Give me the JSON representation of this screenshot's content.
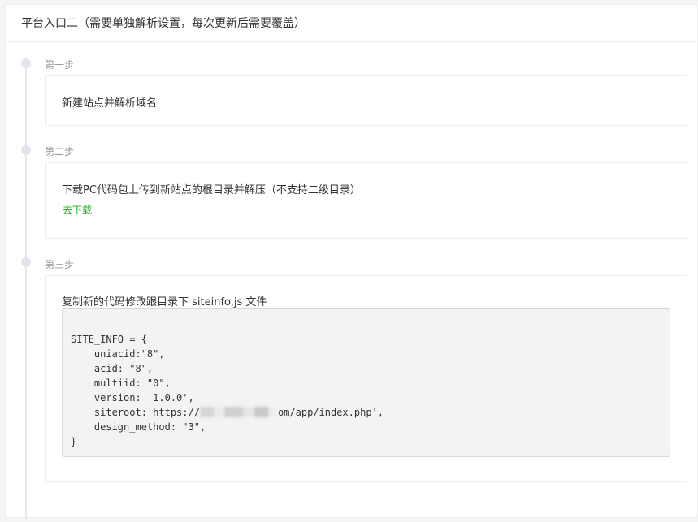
{
  "header": {
    "title": "平台入口二（需要单独解析设置，每次更新后需要覆盖）"
  },
  "steps": [
    {
      "title": "第一步",
      "text": "新建站点并解析域名"
    },
    {
      "title": "第二步",
      "text": "下载PC代码包上传到新站点的根目录并解压（不支持二级目录）",
      "link": "去下载"
    },
    {
      "title": "第三步",
      "text": "复制新的代码修改跟目录下 siteinfo.js 文件"
    }
  ],
  "code": {
    "line1": "SITE_INFO = {",
    "line2": "    uniacid:\"8\",",
    "line3": "    acid: \"8\",",
    "line4": "    multiid: \"0\",",
    "line5": "    version: '1.0.0',",
    "line6_prefix": "    siteroot: https://",
    "line6_suffix": "om/app/index.php',",
    "line7": "    design_method: \"3\",",
    "line8": "}"
  },
  "colors": {
    "link": "#1aad19",
    "step_title": "#999999",
    "timeline": "#e3e4ee"
  }
}
